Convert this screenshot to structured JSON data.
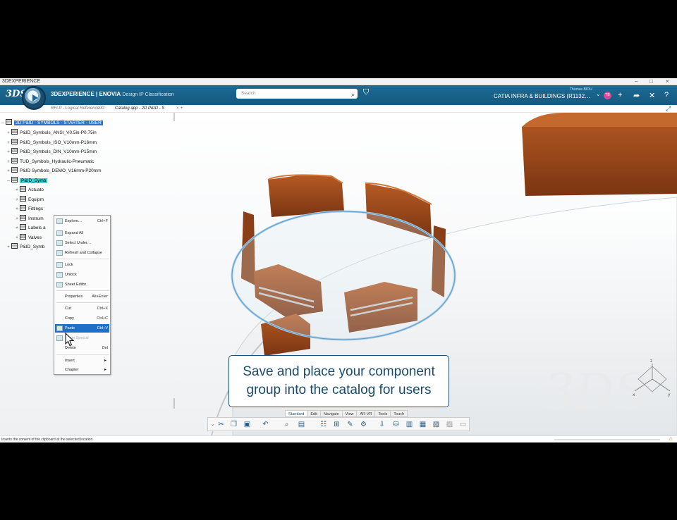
{
  "window": {
    "title": "3DEXPERIENCE"
  },
  "topbar": {
    "brand_main": "3DEXPERIENCE | ENOVIA",
    "brand_sub": "Design IP Classification",
    "compass_label": "V,R",
    "search_placeholder": "Search",
    "user_name": "Thomas BIOU",
    "app_name": "CATIA INFRA & BUILDINGS (R1132…",
    "avatar_initials": "TB"
  },
  "tabs": [
    {
      "label": "RFLP - Logical Reference00:",
      "active": false
    },
    {
      "label": "Catalog app - 2D P&ID - S",
      "active": true
    }
  ],
  "tree": {
    "root": "2D P&ID - SYMBOLS - STARTER - USER",
    "items": [
      "P&ID_Symbols_ANSI_V0.5in-P0.75in",
      "P&ID_Symbols_ISO_V10mm-P16mm",
      "P&ID_Symbols_DIN_V10mm-P15mm",
      "TUD_Symbols_Hydraulic-Pneumatic",
      "P&ID Symbols_DEMO_V16mm-P20mm",
      "P&ID_Symb",
      "Actuato",
      "Equipm",
      "Fittings",
      "Instrum",
      "Labels a",
      "Valves",
      "P&ID_Symb"
    ]
  },
  "context_menu": {
    "items": [
      {
        "label": "Explore…",
        "shortcut": "Ctrl+F"
      },
      {
        "label": "Expand All",
        "shortcut": ""
      },
      {
        "label": "Select Under…",
        "shortcut": ""
      },
      {
        "label": "Refresh and Collapse",
        "shortcut": ""
      },
      {
        "label": "Lock",
        "shortcut": ""
      },
      {
        "label": "Unlock",
        "shortcut": ""
      },
      {
        "label": "Sheet Editor",
        "shortcut": ""
      },
      {
        "label": "Properties",
        "shortcut": "Alt+Enter"
      },
      {
        "label": "Cut",
        "shortcut": "Ctrl+X"
      },
      {
        "label": "Copy",
        "shortcut": "Ctrl+C"
      },
      {
        "label": "Paste",
        "shortcut": "Ctrl+V"
      },
      {
        "label": "Paste Special",
        "shortcut": ""
      },
      {
        "label": "Delete",
        "shortcut": "Del"
      },
      {
        "label": "Insert",
        "shortcut": ""
      },
      {
        "label": "Chapter",
        "shortcut": ""
      }
    ]
  },
  "caption": {
    "line1": "Save and place your component",
    "line2": "group into the catalog for users"
  },
  "action_bar": {
    "tabs": [
      "Standard",
      "Edit",
      "Navigate",
      "View",
      "AR-VR",
      "Tools",
      "Touch"
    ]
  },
  "status": {
    "text": "Inserts the content of the clipboard at the selected location."
  },
  "colors": {
    "topbar": "#1c6a93",
    "selection": "#2b74c7",
    "cyan_selection": "#3ad4d4",
    "folder": "#9a4a1c",
    "caption_text": "#1a4a6a"
  }
}
